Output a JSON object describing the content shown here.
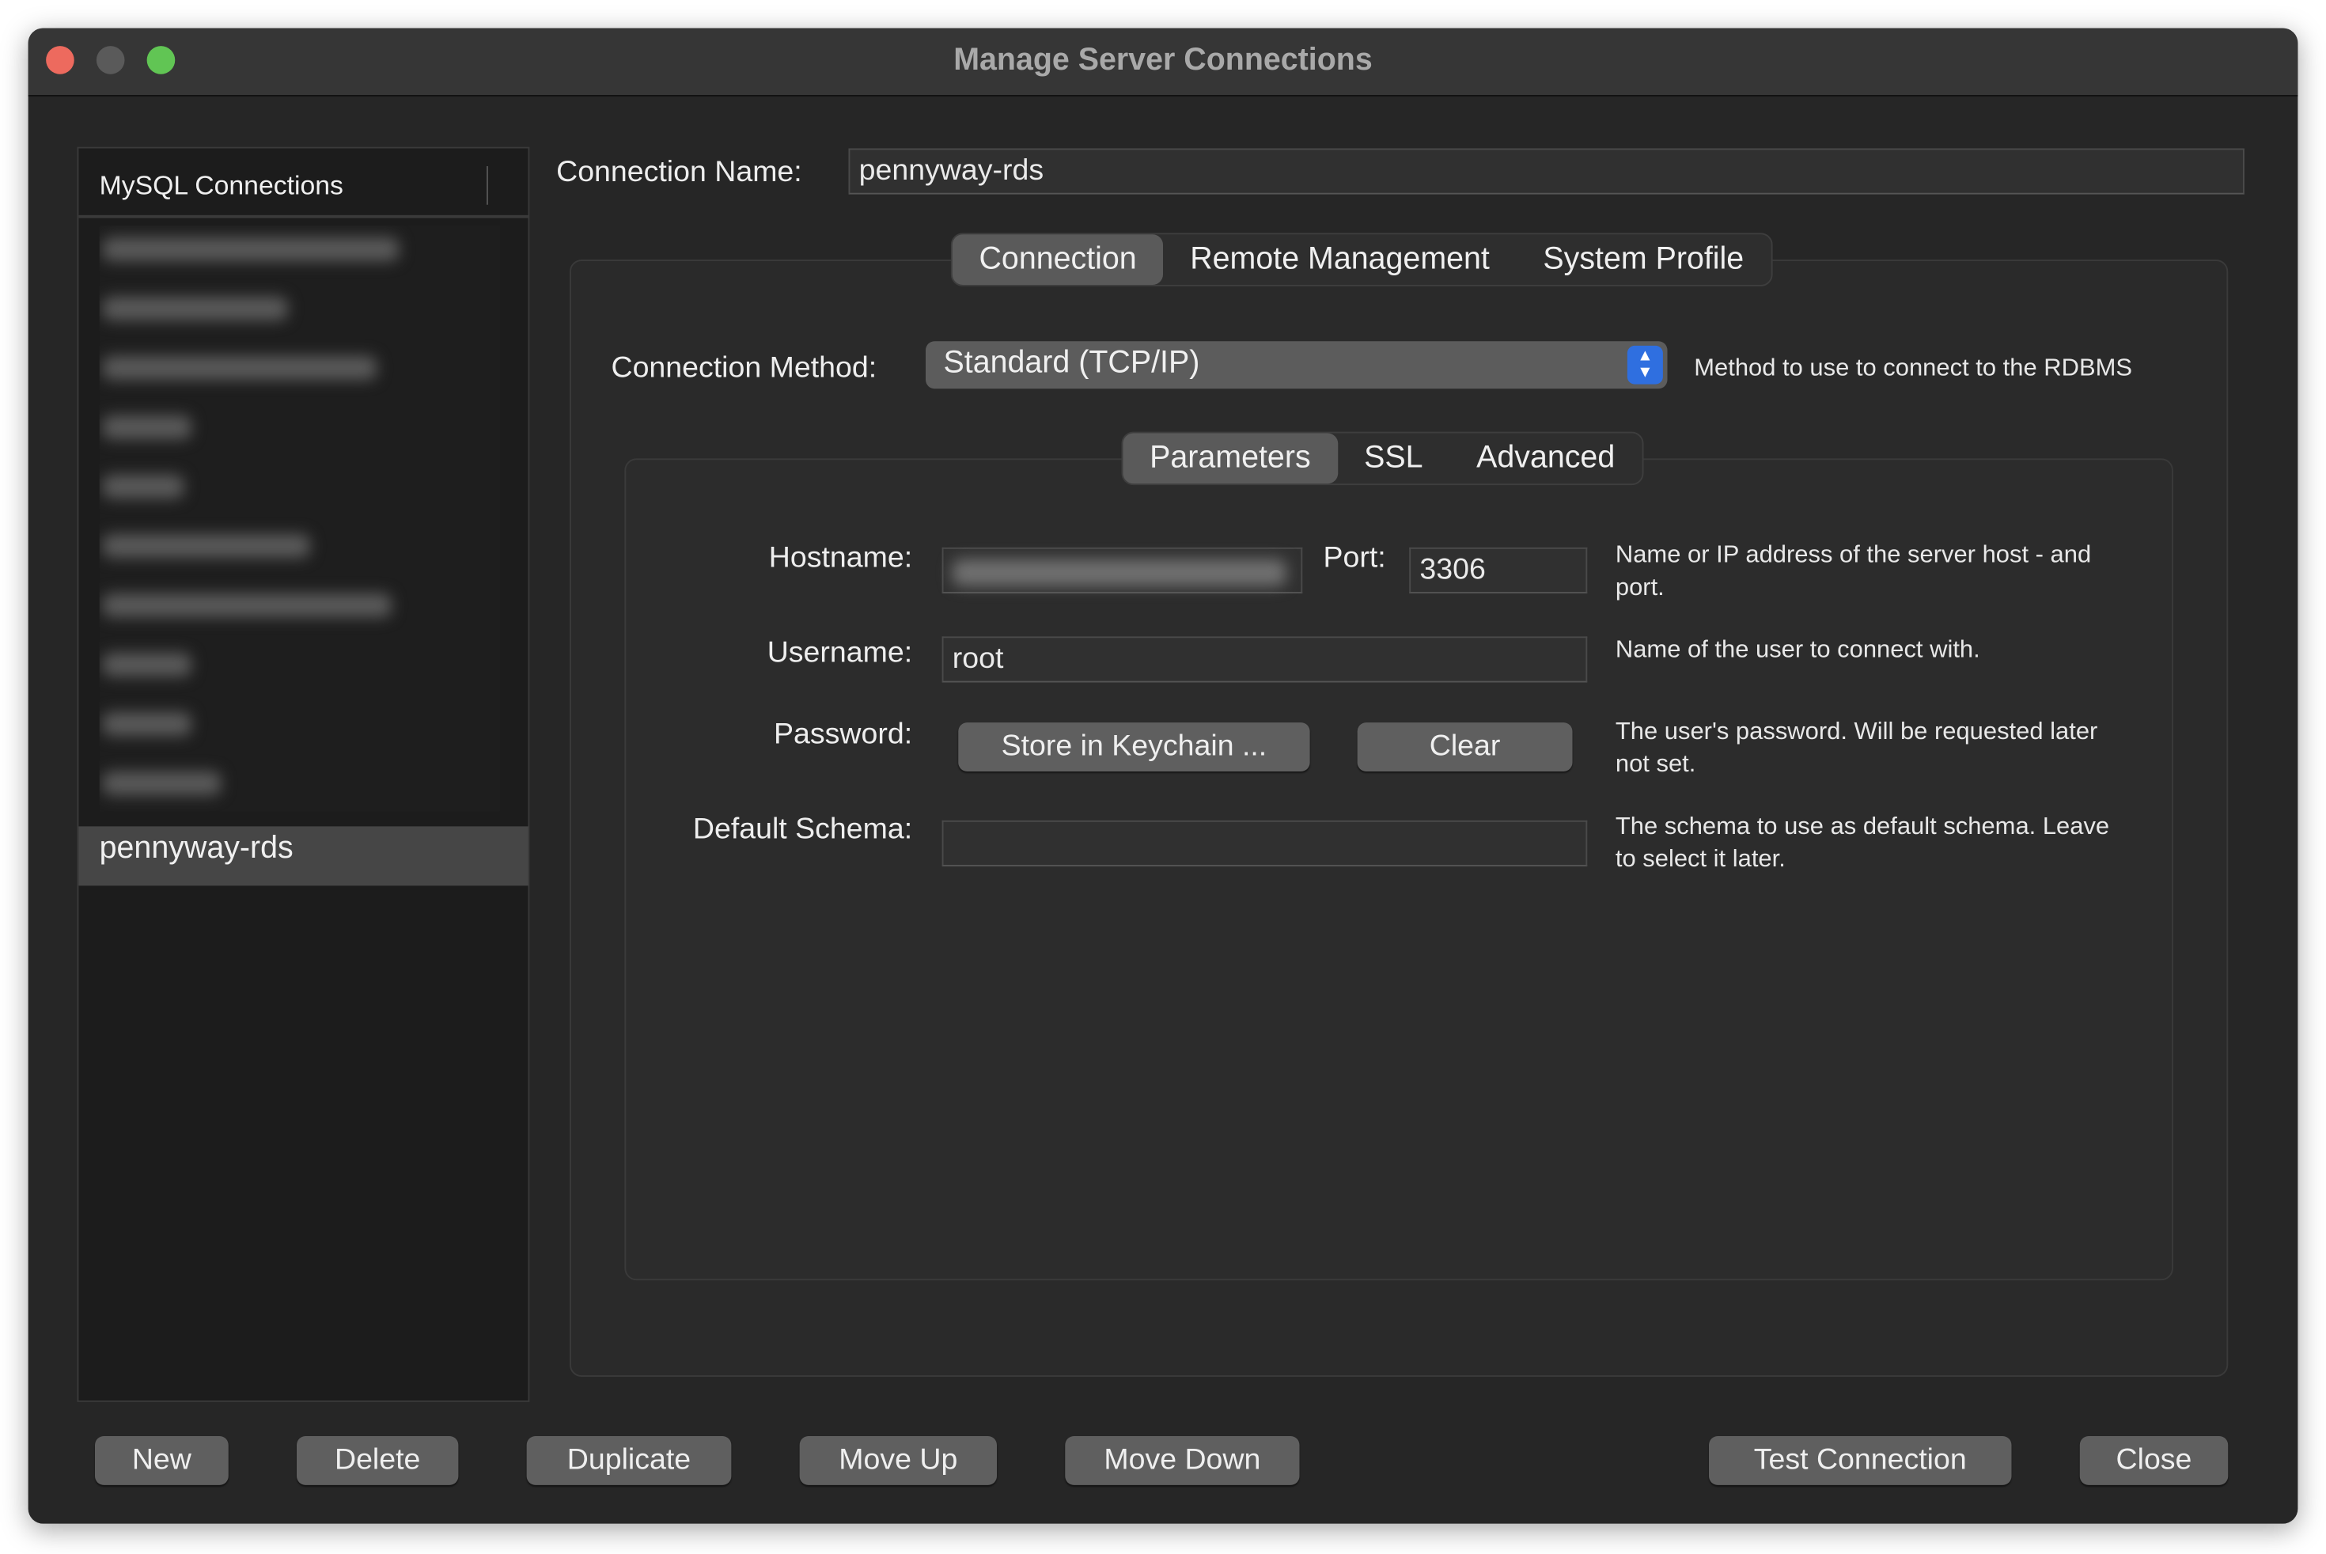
{
  "window": {
    "title": "Manage Server Connections"
  },
  "sidebar": {
    "header": "MySQL Connections",
    "selected_item": "pennyway-rds"
  },
  "connection_name": {
    "label": "Connection Name:",
    "value": "pennyway-rds"
  },
  "tabs": [
    {
      "label": "Connection",
      "active": true
    },
    {
      "label": "Remote Management",
      "active": false
    },
    {
      "label": "System Profile",
      "active": false
    }
  ],
  "connection_method": {
    "label": "Connection Method:",
    "value": "Standard (TCP/IP)",
    "help": "Method to use to connect to the RDBMS"
  },
  "subtabs": [
    {
      "label": "Parameters",
      "active": true
    },
    {
      "label": "SSL",
      "active": false
    },
    {
      "label": "Advanced",
      "active": false
    }
  ],
  "params": {
    "hostname": {
      "label": "Hostname:",
      "help_line1": "Name or IP address of the server host - and",
      "help_line2": "port."
    },
    "port": {
      "label": "Port:",
      "value": "3306"
    },
    "username": {
      "label": "Username:",
      "value": "root",
      "help": "Name of the user to connect with."
    },
    "password": {
      "label": "Password:",
      "store_button": "Store in Keychain ...",
      "clear_button": "Clear",
      "help_line1": "The user's password. Will be requested later",
      "help_line2": "not set."
    },
    "default_schema": {
      "label": "Default Schema:",
      "value": "",
      "help_line1": "The schema to use as default schema. Leave",
      "help_line2": "to select it later."
    }
  },
  "buttons": {
    "new": "New",
    "delete": "Delete",
    "duplicate": "Duplicate",
    "move_up": "Move Up",
    "move_down": "Move Down",
    "test_connection": "Test Connection",
    "close": "Close"
  },
  "colors": {
    "accent": "#2f6fe0",
    "close_light": "#ed6a5e",
    "minimize_light": "#5a5a5a",
    "zoom_light": "#61c554"
  }
}
